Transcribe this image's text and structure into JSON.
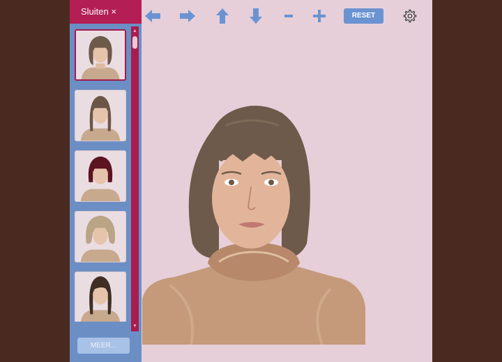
{
  "sidebar": {
    "close_label": "Sluiten ×",
    "more_label": "MEER...",
    "thumbnails": [
      {
        "hair_color": "#6e5a4a",
        "style": "bob with bangs",
        "selected": true
      },
      {
        "hair_color": "#6b5646",
        "style": "long straight with bangs",
        "selected": false
      },
      {
        "hair_color": "#5c1420",
        "style": "burgundy bob with bangs",
        "selected": false
      },
      {
        "hair_color": "#b9a486",
        "style": "blonde shaggy bob",
        "selected": false
      },
      {
        "hair_color": "#3e2e24",
        "style": "long straight dark",
        "selected": false
      }
    ]
  },
  "toolbar": {
    "tools": [
      "arrow-left-icon",
      "arrow-right-icon",
      "arrow-up-icon",
      "arrow-down-icon",
      "minus-icon",
      "plus-icon"
    ],
    "reset_label": "RESET",
    "settings_icon": "gear-icon"
  },
  "colors": {
    "stage_background": "#e6cfd9",
    "page_background": "#4a2a20",
    "sidebar": "#6b8fc4",
    "close_header": "#b31e55",
    "scrollbar": "#a81c4e",
    "tool_icon": "#6b93d1",
    "current_hair": "#6e5a4a",
    "top": "#c49a7a"
  }
}
